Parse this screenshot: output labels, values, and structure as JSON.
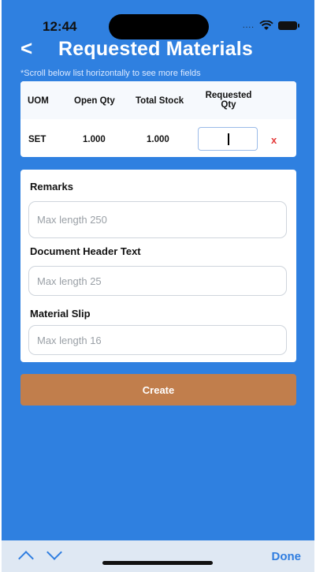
{
  "status": {
    "time": "12:44",
    "carrier_dots": "....",
    "wifi_icon": "wifi-icon",
    "battery_icon": "battery-icon"
  },
  "header": {
    "back_label": "<",
    "title": "Requested Materials"
  },
  "hint": "*Scroll below list horizontally to see more fields",
  "table": {
    "columns": [
      "UOM",
      "Open Qty",
      "Total Stock",
      "Requested Qty"
    ],
    "row": {
      "uom": "SET",
      "open_qty": "1.000",
      "total_stock": "1.000",
      "requested_qty": ""
    },
    "remove_label": "x"
  },
  "form": {
    "remarks_label": "Remarks",
    "remarks_placeholder": "Max length 250",
    "doc_header_label": "Document Header Text",
    "doc_header_placeholder": "Max length 25",
    "material_slip_label": "Material Slip",
    "material_slip_placeholder": "Max length 16"
  },
  "create_label": "Create",
  "accessory": {
    "done_label": "Done"
  },
  "colors": {
    "primary": "#2f80e0",
    "create": "#c17e4c",
    "remove": "#e43a3a"
  }
}
